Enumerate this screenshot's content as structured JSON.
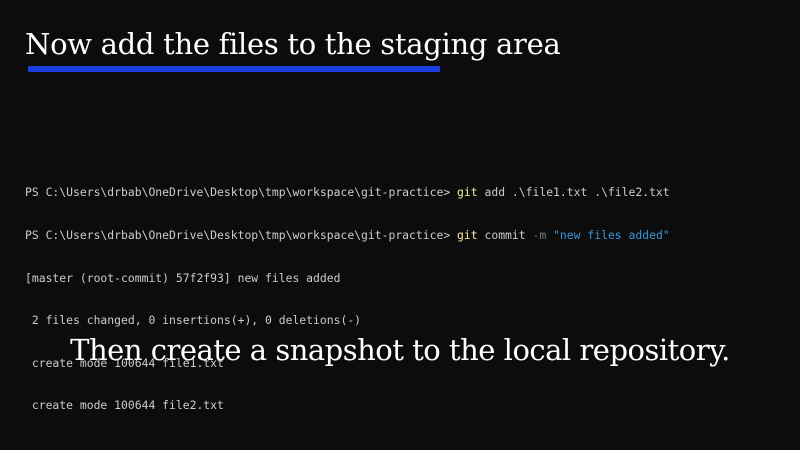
{
  "slide": {
    "title": "Now add the files to the staging area",
    "caption": "Then create a snapshot to the local repository."
  },
  "terminal": {
    "line1": {
      "prompt": "PS C:\\Users\\drbab\\OneDrive\\Desktop\\tmp\\workspace\\git-practice> ",
      "command": "git",
      "args": " add .\\file1.txt .\\file2.txt"
    },
    "line2": {
      "prompt": "PS C:\\Users\\drbab\\OneDrive\\Desktop\\tmp\\workspace\\git-practice> ",
      "command": "git",
      "args": " commit ",
      "flag": "-m",
      "space": " ",
      "message": "\"new files added\""
    },
    "output": [
      "[master (root-commit) 57f2f93] new files added",
      " 2 files changed, 0 insertions(+), 0 deletions(-)",
      " create mode 100644 file1.txt",
      " create mode 100644 file2.txt"
    ]
  },
  "colors": {
    "background": "#0c0c0c",
    "underline": "#1a3ce0",
    "command": "#f9f1a5",
    "string": "#3a96dd",
    "flag": "#767676",
    "terminal_text": "#cccccc"
  }
}
